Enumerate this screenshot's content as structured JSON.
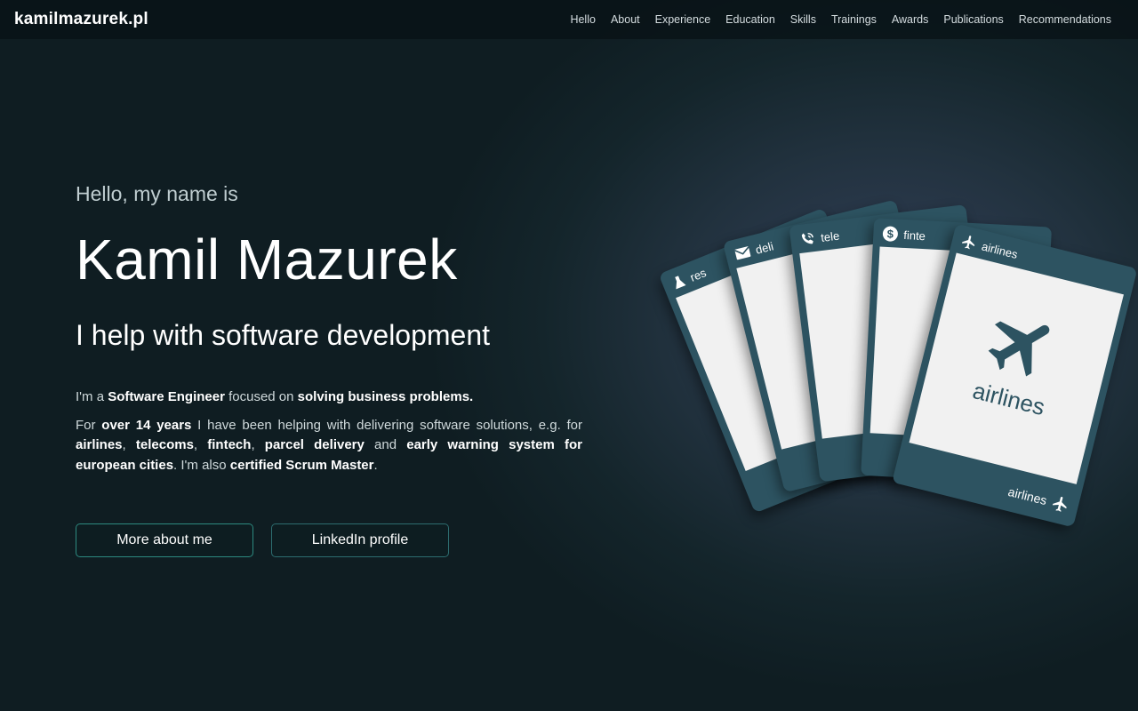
{
  "nav": {
    "brand": "kamilmazurek.pl",
    "links": [
      "Hello",
      "About",
      "Experience",
      "Education",
      "Skills",
      "Trainings",
      "Awards",
      "Publications",
      "Recommendations"
    ]
  },
  "hero": {
    "greeting": "Hello, my name is",
    "name": "Kamil Mazurek",
    "tagline": "I help with software development",
    "intro1": {
      "a": "I'm a ",
      "b": "Software Engineer",
      "c": " focused on ",
      "d": "solving business problems."
    },
    "intro2": {
      "a": "For ",
      "b": "over 14 years",
      "c": " I have been helping with delivering software solutions, e.g. for ",
      "d": "airlines",
      "e": ", ",
      "f": "telecoms",
      "g": ", ",
      "h": "fintech",
      "i": ", ",
      "j": "parcel delivery",
      "k": " and ",
      "l": "early warning system for european cities",
      "m": ". I'm also ",
      "n": "certified Scrum Master",
      "o": "."
    }
  },
  "buttons": {
    "more": "More about me",
    "linkedin": "LinkedIn profile"
  },
  "cards": {
    "card1": "res",
    "card2": "deli",
    "card3": "tele",
    "card4": "finte",
    "card5": "airlines",
    "main_label": "airlines",
    "foot_label": "airlines"
  },
  "colors": {
    "card": "#2d5361",
    "card_face": "#f1f1f1",
    "button_border": "#2d8a80"
  }
}
